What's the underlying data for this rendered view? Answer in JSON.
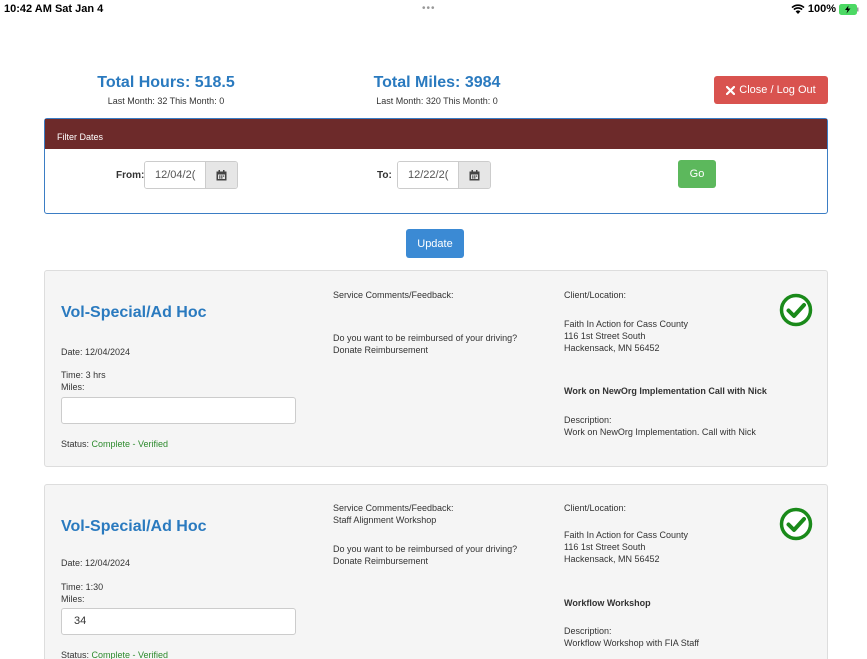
{
  "statusbar": {
    "time": "10:42 AM  Sat Jan 4",
    "dots": "•••",
    "battery": "100%"
  },
  "totals": {
    "hours_label": "Total Hours: 518.5",
    "hours_sub": "Last Month: 32   This Month: 0",
    "miles_label": "Total Miles: 3984",
    "miles_sub": "Last Month: 320   This Month: 0"
  },
  "logout": {
    "label": "Close / Log Out",
    "icon": "close-x-icon",
    "color": "#d9534f"
  },
  "filter": {
    "header": "Filter Dates",
    "from_label": "From:",
    "from_value": "12/04/2(",
    "to_label": "To:",
    "to_value": "12/22/2(",
    "go_label": "Go",
    "header_color": "#6d2a2a"
  },
  "update_label": "Update",
  "cards": [
    {
      "title": "Vol-Special/Ad Hoc",
      "date": "Date: 12/04/2024",
      "time": "Time: 3 hrs",
      "miles_label": "Miles:",
      "miles_value": "",
      "status_label": "Status:",
      "status_value": "Complete - Verified",
      "comments_label": "Service Comments/Feedback:",
      "comments_value": "",
      "reimburse_q": "Do you want to be reimbursed of your driving?",
      "reimburse_a": "Donate Reimbursement",
      "client_label": "Client/Location:",
      "client_name": "Faith In Action for Cass County",
      "client_addr1": "116 1st Street South",
      "client_addr2": "Hackensack, MN 56452",
      "task_title": "Work on NewOrg Implementation Call with Nick",
      "desc_label": "Description:",
      "desc_value": "Work on NewOrg Implementation. Call with Nick"
    },
    {
      "title": "Vol-Special/Ad Hoc",
      "date": "Date: 12/04/2024",
      "time": "Time: 1:30",
      "miles_label": "Miles:",
      "miles_value": "34",
      "status_label": "Status:",
      "status_value": "Complete - Verified",
      "comments_label": "Service Comments/Feedback:",
      "comments_value": "Staff Alignment Workshop",
      "reimburse_q": "Do you want to be reimbursed of your driving?",
      "reimburse_a": "Donate Reimbursement",
      "client_label": "Client/Location:",
      "client_name": "Faith In Action for Cass County",
      "client_addr1": "116 1st Street South",
      "client_addr2": "Hackensack, MN 56452",
      "task_title": "Workflow Workshop",
      "desc_label": "Description:",
      "desc_value": "Workflow Workshop with FIA Staff"
    }
  ]
}
